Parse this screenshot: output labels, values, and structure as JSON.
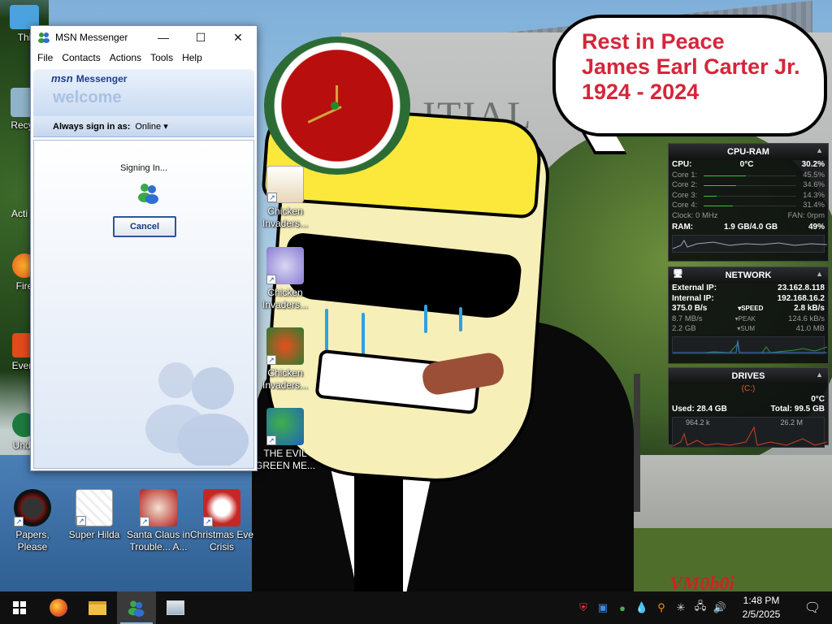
{
  "wallpaper": {
    "building_sign": "ITIAL",
    "speech_bubble": [
      "Rest in Peace",
      "James Earl Carter Jr.",
      "1924 - 2024"
    ],
    "watermark": "VM0b0i"
  },
  "desktop_icons": [
    {
      "label": "Chicken Invaders...",
      "icon": "chicken-invaders-icon"
    },
    {
      "label": "Chicken Invaders...",
      "icon": "chicken-invaders-icon"
    },
    {
      "label": "Chicken Invaders...",
      "icon": "chicken-invaders-icon"
    },
    {
      "label": "THE EVIL GREEN ME...",
      "icon": "msn-buddies-icon"
    },
    {
      "label": "Papers, Please",
      "icon": "papers-please-icon"
    },
    {
      "label": "Super Hilda",
      "icon": "super-hilda-icon"
    },
    {
      "label": "Santa Claus in Trouble... A...",
      "icon": "santa-claus-icon"
    },
    {
      "label": "Christmas Eve Crisis",
      "icon": "christmas-eve-icon"
    }
  ],
  "partial_labels": [
    "Thi",
    "Recyc",
    "Acti",
    "Fire",
    "Every",
    "Unde"
  ],
  "msn": {
    "title": "MSN Messenger",
    "menu": [
      "File",
      "Contacts",
      "Actions",
      "Tools",
      "Help"
    ],
    "logo": "msn",
    "logo_suffix": "Messenger",
    "welcome": "welcome",
    "always_sign_in_label": "Always sign in as:",
    "status": "Online",
    "signing_in": "Signing In...",
    "cancel": "Cancel"
  },
  "cpu_ram": {
    "title": "CPU-RAM",
    "cpu_label": "CPU:",
    "cpu_temp": "0°C",
    "cpu_value": "30.2%",
    "cores": [
      {
        "label": "Core 1:",
        "value": "45.5%",
        "fraction": 0.455
      },
      {
        "label": "Core 2:",
        "value": "34.6%",
        "fraction": 0.346
      },
      {
        "label": "Core 3:",
        "value": "14.3%",
        "fraction": 0.143
      },
      {
        "label": "Core 4:",
        "value": "31.4%",
        "fraction": 0.314
      }
    ],
    "clock": "Clock: 0 MHz",
    "fan": "FAN: 0rpm",
    "ram_label": "RAM:",
    "ram_used": "1.9 GB/4.0 GB",
    "ram_value": "49%"
  },
  "network": {
    "title": "NETWORK",
    "external_label": "External IP:",
    "external_ip": "23.162.8.118",
    "internal_label": "Internal IP:",
    "internal_ip": "192.168.16.2",
    "down_speed": "375.0 B/s",
    "speed_label": "SPEED",
    "up_speed": "2.8 kB/s",
    "down_peak": "8.7 MB/s",
    "peak_label": "PEAK",
    "up_peak": "124.6 kB/s",
    "down_sum": "2.2 GB",
    "sum_label": "SUM",
    "up_sum": "41.0 MB"
  },
  "drives": {
    "title": "DRIVES",
    "drive": "(C:)",
    "temp": "0°C",
    "used": "Used: 28.4 GB",
    "total": "Total: 99.5 GB",
    "read": "964.2 k",
    "write": "26.2 M"
  },
  "taskbar": {
    "apps": [
      "start-button",
      "firefox",
      "file-explorer",
      "msn-messenger",
      "control-panel"
    ],
    "time": "1:48 PM",
    "date": "2/5/2025"
  }
}
